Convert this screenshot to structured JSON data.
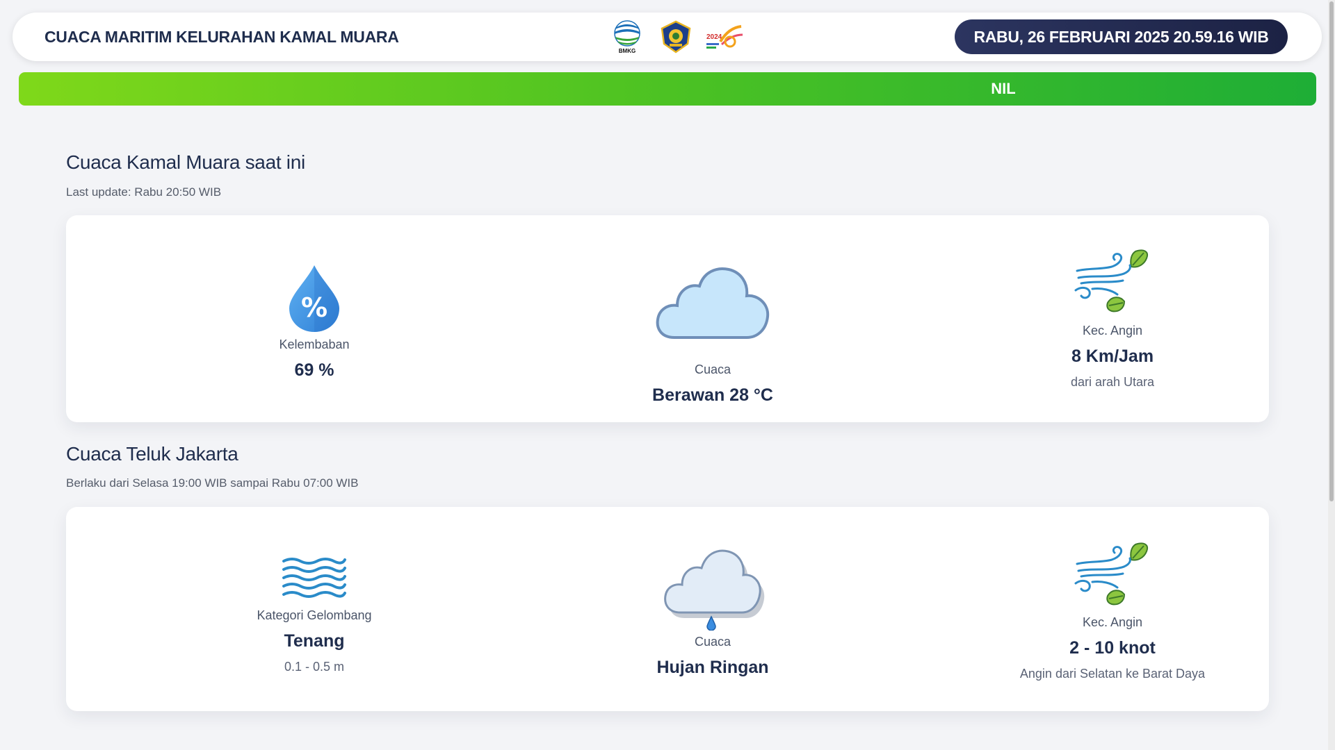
{
  "header": {
    "title": "CUACA MARITIM KELURAHAN KAMAL MUARA",
    "datetime": "RABU, 26 FEBRUARI 2025 20.59.16 WIB",
    "logos": [
      {
        "icon": "bmkg-logo",
        "text": "BMKG"
      },
      {
        "icon": "pemprov-emblem"
      },
      {
        "icon": "event-2024-logo"
      }
    ]
  },
  "alert_bar": {
    "text": "NIL",
    "gradient": [
      "#7fd81a",
      "#1eae36"
    ]
  },
  "current": {
    "title": "Cuaca Kamal Muara saat ini",
    "subtitle": "Last update: Rabu 20:50 WIB",
    "humidity": {
      "icon": "humidity-drop-icon",
      "label": "Kelembaban",
      "value": "69 %"
    },
    "weather": {
      "icon": "cloud-icon",
      "label": "Cuaca",
      "value": "Berawan 28 °C"
    },
    "wind": {
      "icon": "wind-leaves-icon",
      "label": "Kec. Angin",
      "value": "8 Km/Jam",
      "note": "dari arah Utara"
    }
  },
  "bay": {
    "title": "Cuaca Teluk Jakarta",
    "subtitle": "Berlaku dari Selasa 19:00 WIB sampai Rabu 07:00 WIB",
    "waves": {
      "icon": "waves-icon",
      "label": "Kategori Gelombang",
      "value": "Tenang",
      "note": "0.1 - 0.5 m"
    },
    "weather": {
      "icon": "rain-cloud-icon",
      "label": "Cuaca",
      "value": "Hujan Ringan"
    },
    "wind": {
      "icon": "wind-leaves-icon",
      "label": "Kec. Angin",
      "value": "2 - 10 knot",
      "note": "Angin dari Selatan ke Barat Daya"
    }
  },
  "colors": {
    "navy": "#1f2d4d",
    "clock_bg": "#2c3560",
    "drop_blue": "#3b8de0",
    "cloud_fill": "#c7e6fb",
    "leaf_green": "#8cc63f"
  }
}
